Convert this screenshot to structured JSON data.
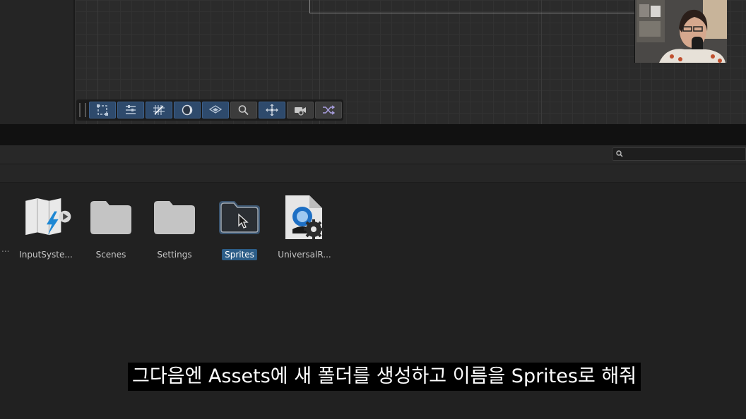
{
  "scene_view": {
    "toolbar": [
      {
        "id": "rect-tool",
        "icon": "rect-transform-icon"
      },
      {
        "id": "layout-tool",
        "icon": "sliders-icon"
      },
      {
        "id": "grid-tool",
        "icon": "grid-snap-icon"
      },
      {
        "id": "shading-tool",
        "icon": "shading-mode-icon"
      },
      {
        "id": "layers-tool",
        "icon": "layers-icon"
      },
      {
        "id": "search-tool",
        "icon": "magnifier-icon"
      },
      {
        "id": "pivot-tool",
        "icon": "pivot-icon"
      },
      {
        "id": "camera-tool",
        "icon": "camera-icon"
      },
      {
        "id": "shuffle-tool",
        "icon": "shuffle-icon"
      }
    ]
  },
  "project": {
    "search": {
      "placeholder": ""
    },
    "assets": [
      {
        "label": "InputSyste...",
        "icon": "input-actions-icon",
        "selected": false
      },
      {
        "label": "Scenes",
        "icon": "folder-icon",
        "selected": false
      },
      {
        "label": "Settings",
        "icon": "folder-icon",
        "selected": false
      },
      {
        "label": "Sprites",
        "icon": "folder-open-icon",
        "selected": true
      },
      {
        "label": "UniversalR...",
        "icon": "render-pipeline-asset-icon",
        "selected": false
      }
    ],
    "left_truncation": "..."
  },
  "subtitle": {
    "text": "그다음엔 Assets에 새 폴더를 생성하고 이름을 Sprites로 해줘"
  },
  "colors": {
    "selected_label_bg": "#2c5d87",
    "toolbar_active": "#2e4a6c",
    "folder_fill": "#c4c4c4"
  }
}
